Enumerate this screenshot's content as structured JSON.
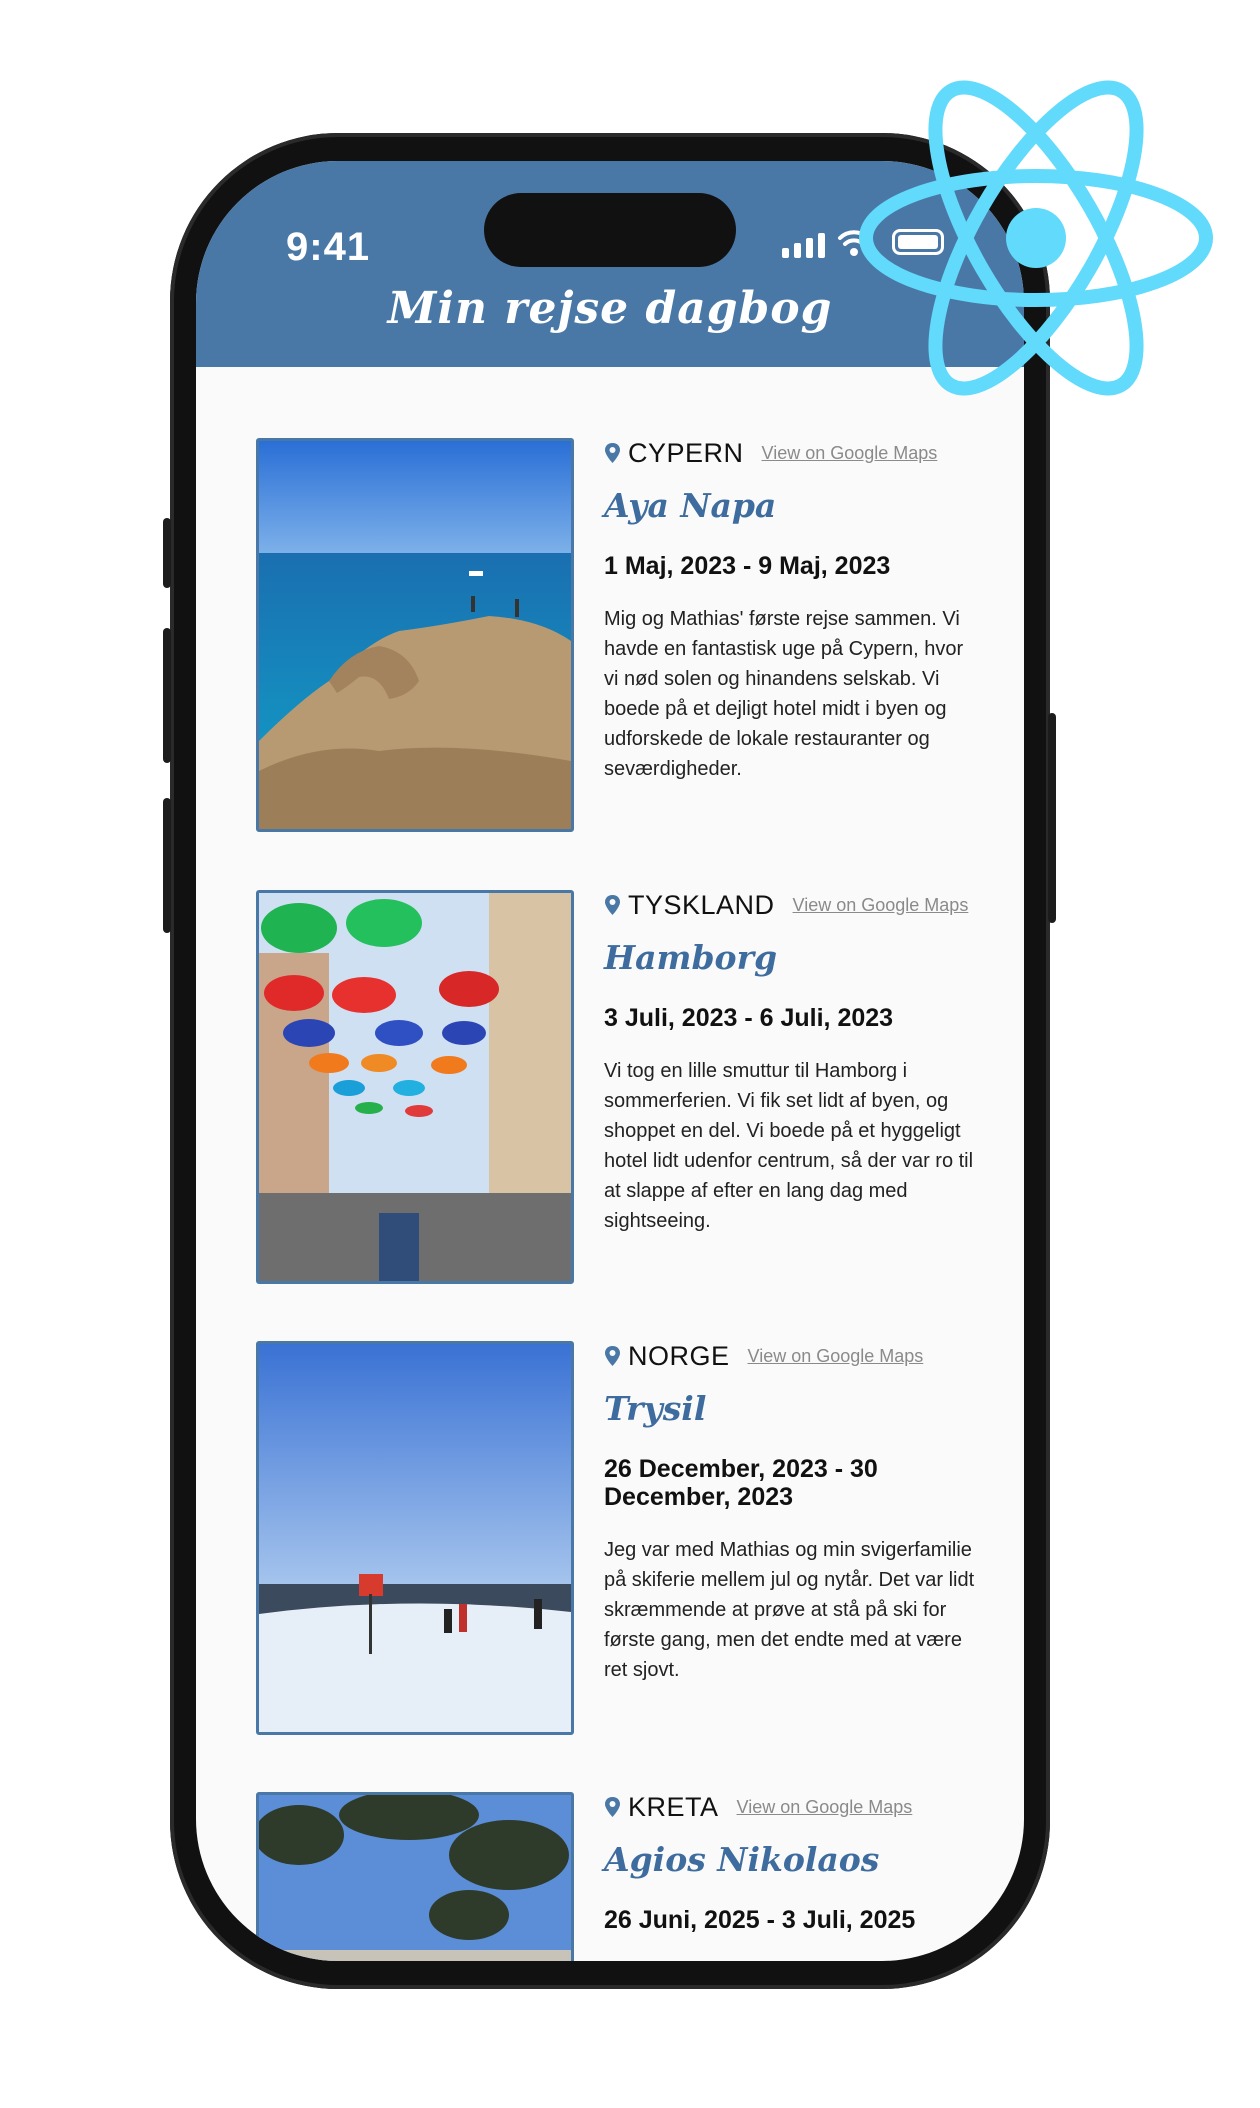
{
  "status_bar": {
    "time": "9:41"
  },
  "app": {
    "title": "Min rejse dagbog"
  },
  "maps_link_label": "View on Google Maps",
  "entries": [
    {
      "country": "CYPERN",
      "place": "Aya Napa",
      "dates": "1 Maj, 2023 - 9 Maj, 2023",
      "description": "Mig og Mathias' første rejse sammen. Vi havde en fantastisk uge på Cypern, hvor vi nød solen og hinandens selskab. Vi boede på et dejligt hotel midt i byen og udforskede de lokale restauranter og seværdigheder."
    },
    {
      "country": "TYSKLAND",
      "place": "Hamborg",
      "dates": "3 Juli, 2023 - 6 Juli, 2023",
      "description": "Vi tog en lille smuttur til Hamborg i sommerferien. Vi fik set lidt af byen, og shoppet en del. Vi boede på et hyggeligt hotel lidt udenfor centrum, så der var ro til at slappe af efter en lang dag med sightseeing."
    },
    {
      "country": "NORGE",
      "place": "Trysil",
      "dates": "26 December, 2023 - 30 December, 2023",
      "description": "Jeg var med Mathias og min svigerfamilie på skiferie mellem jul og nytår. Det var lidt skræmmende at prøve at stå på ski for første gang, men det endte med at være ret sjovt."
    },
    {
      "country": "KRETA",
      "place": "Agios Nikolaos",
      "dates": "26 Juni, 2025 - 3 Juli, 2025",
      "description": ""
    }
  ],
  "colors": {
    "header": "#4a78a6",
    "accent": "#3e6c9e",
    "react": "#61dafb"
  }
}
